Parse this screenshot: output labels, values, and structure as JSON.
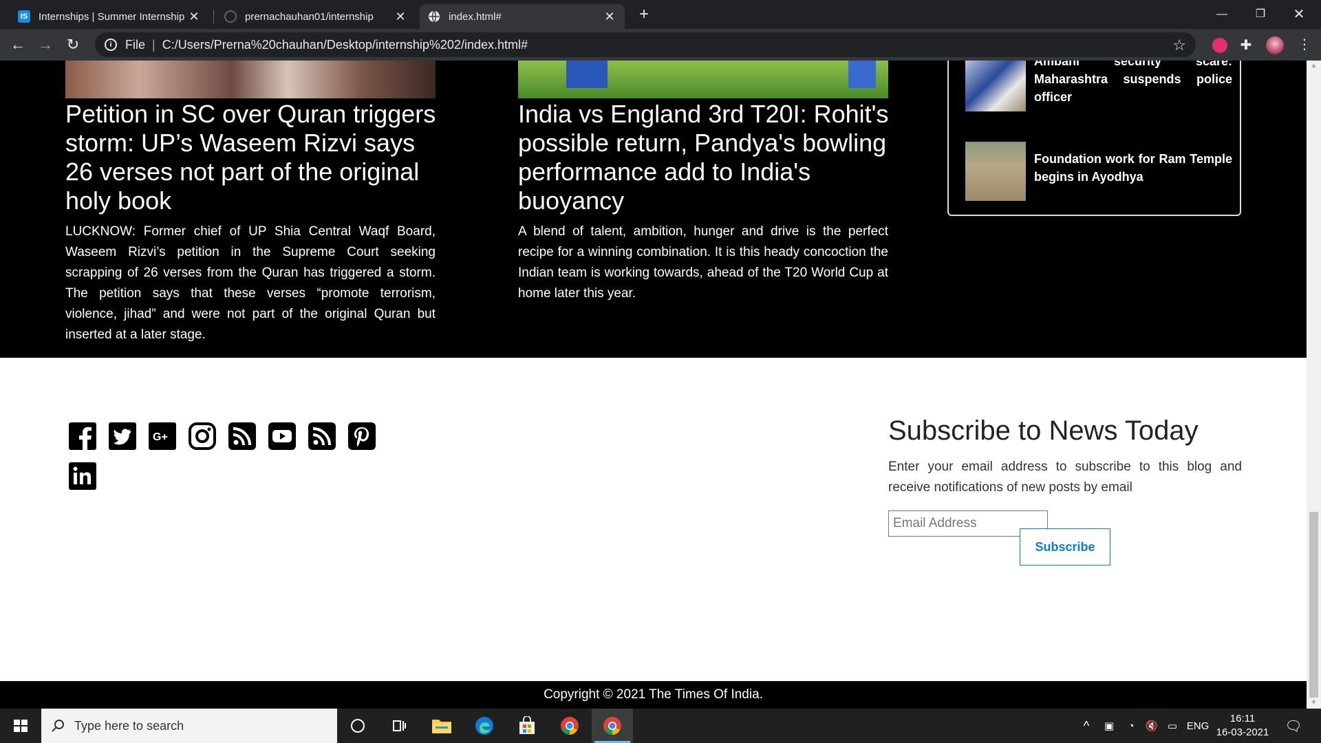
{
  "browser": {
    "tabs": [
      {
        "title": "Internships | Summer Internship",
        "favicon": "IS",
        "active": false
      },
      {
        "title": "prernachauhan01/internship",
        "favicon": "github-icon",
        "active": false
      },
      {
        "title": "index.html#",
        "favicon": "globe-icon",
        "active": true
      }
    ],
    "address": {
      "scheme_label": "File",
      "url": "C:/Users/Prerna%20chauhan/Desktop/internship%202/index.html#"
    }
  },
  "news": {
    "articles": [
      {
        "headline": "Petition in SC over Quran triggers storm: UP’s Waseem Rizvi says 26 verses not part of the original holy book",
        "body": "LUCKNOW: Former chief of UP Shia Central Waqf Board, Waseem Rizvi’s petition in the Supreme Court seeking scrapping of 26 verses from the Quran has triggered a storm. The petition says that these verses “promote terrorism, violence, jihad” and were not part of the original Quran but inserted at a later stage."
      },
      {
        "headline": "India vs England 3rd T20I: Rohit's possible return, Pandya's bowling performance add to India's buoyancy",
        "body": "A blend of talent, ambition, hunger and drive is the perfect recipe for a winning combination. It is this heady concoction the Indian team is working towards, ahead of the T20 World Cup at home later this year."
      }
    ],
    "trending": [
      {
        "title": "Ambani security scare: Maharashtra suspends police officer"
      },
      {
        "title": "Foundation work for Ram Temple begins in Ayodhya"
      }
    ]
  },
  "footer": {
    "social_icons": [
      "facebook-icon",
      "twitter-icon",
      "google-plus-icon",
      "instagram-icon",
      "rss-icon",
      "youtube-icon",
      "rss-icon",
      "pinterest-icon",
      "linkedin-icon"
    ],
    "subscribe": {
      "title": "Subscribe to News Today",
      "description": "Enter your email address to subscribe to this blog and receive notifications of new posts by email",
      "email_placeholder": "Email Address",
      "button_label": "Subscribe"
    },
    "copyright": "Copyright © 2021 The Times Of India."
  },
  "taskbar": {
    "search_placeholder": "Type here to search",
    "language": "ENG",
    "time": "16:11",
    "date": "16-03-2021"
  },
  "colors": {
    "accent": "#0d7bd1",
    "page_dark": "#000000",
    "chrome_dark": "#202124"
  }
}
